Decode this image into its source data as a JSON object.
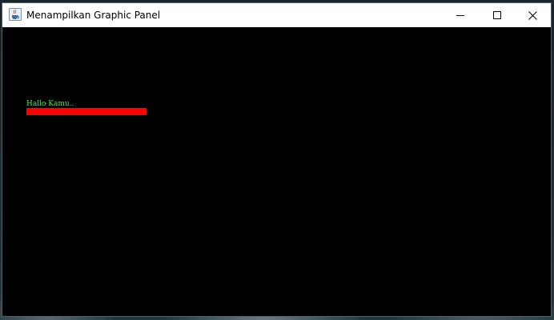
{
  "window": {
    "title": "Menampilkan Graphic Panel",
    "icon": "java-cup-icon",
    "controls": {
      "minimize_icon": "minimize-icon",
      "maximize_icon": "maximize-icon",
      "close_icon": "close-icon"
    }
  },
  "panel": {
    "background_color": "#000000",
    "text": "Hallo Kamu..",
    "text_color": "#33ff33",
    "bar_color": "#ff0000"
  }
}
